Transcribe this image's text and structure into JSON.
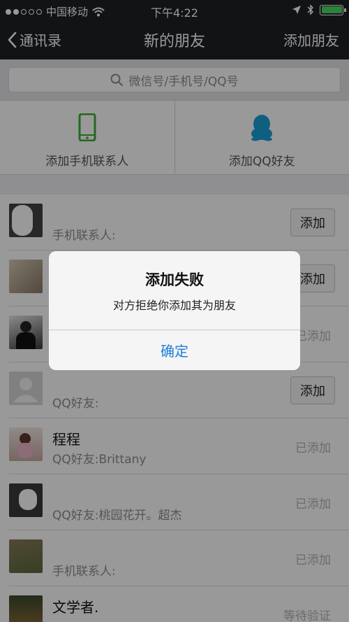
{
  "status_bar": {
    "carrier": "中国移动",
    "time": "下午4:22"
  },
  "nav": {
    "back_label": "通讯录",
    "title": "新的朋友",
    "action_label": "添加朋友"
  },
  "search": {
    "placeholder": "微信号/手机号/QQ号"
  },
  "quick_actions": [
    {
      "label": "添加手机联系人",
      "icon": "phone-icon"
    },
    {
      "label": "添加QQ好友",
      "icon": "qq-penguin-icon"
    }
  ],
  "friends": [
    {
      "name": "",
      "subtitle": "手机联系人:",
      "action": "添加"
    },
    {
      "name": "",
      "subtitle": "",
      "action": "添加"
    },
    {
      "name": "",
      "subtitle": "",
      "action": "已添加"
    },
    {
      "name": "",
      "subtitle": "QQ好友:",
      "action": "添加"
    },
    {
      "name": "程程",
      "subtitle": "QQ好友:Brittany",
      "action": "已添加"
    },
    {
      "name": "",
      "subtitle": "QQ好友:桃园花开。超杰",
      "action": "已添加"
    },
    {
      "name": "",
      "subtitle": "手机联系人:",
      "action": "已添加"
    },
    {
      "name": "文学者.",
      "subtitle": "",
      "action": "等待验证"
    }
  ],
  "alert": {
    "title": "添加失败",
    "message": "对方拒绝你添加其为朋友",
    "confirm_label": "确定"
  },
  "colors": {
    "nav_bg": "#1f2024",
    "accent": "#1a7fd9",
    "phone_icon": "#3cb034",
    "qq_icon": "#1c9ed8",
    "battery": "#4cd964"
  }
}
